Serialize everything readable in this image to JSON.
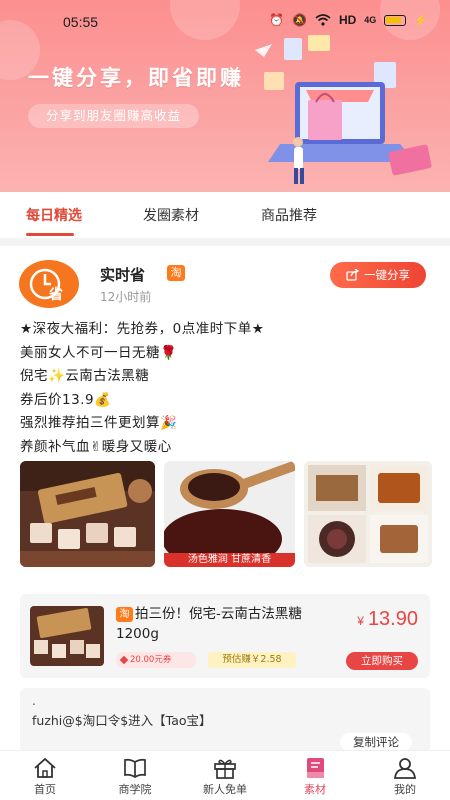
{
  "status_bar": {
    "time": "05:55",
    "network": "HD",
    "signal": "4G"
  },
  "banner": {
    "title": "一键分享，即省即赚",
    "subtitle": "分享到朋友圈赚高收益"
  },
  "tabs": [
    {
      "label": "每日精选",
      "active": true
    },
    {
      "label": "发圈素材",
      "active": false
    },
    {
      "label": "商品推荐",
      "active": false
    }
  ],
  "post": {
    "author": "实时省",
    "avatar_text": "省",
    "platform_badge": "淘",
    "time": "12小时前",
    "share_label": "一键分享",
    "lines": [
      "★深夜大福利：先抢券，0点准时下单★",
      "美丽女人不可一日无糖🌹",
      "倪宅✨云南古法黑糖",
      "券后价13.9💰",
      "强烈推荐拍三件更划算🎉",
      "养颜补气血✌暖身又暖心"
    ],
    "thumb_caption": "汤色雅润 甘蔗清香"
  },
  "product": {
    "badge": "淘",
    "title": "拍三份！倪宅-云南古法黑糖1200g",
    "coupon": "20.00元券",
    "earn": "预估赚￥2.58",
    "price_symbol": "¥",
    "price": "13.90",
    "buy_label": "立即购买"
  },
  "comment": {
    "marker": ".",
    "text": "fuzhi@$淘口令$进入【Tao宝】",
    "copy_label": "复制评论"
  },
  "bottom_nav": [
    {
      "label": "首页",
      "icon": "home-icon",
      "active": false
    },
    {
      "label": "商学院",
      "icon": "book-icon",
      "active": false
    },
    {
      "label": "新人免单",
      "icon": "gift-icon",
      "active": false
    },
    {
      "label": "素材",
      "icon": "material-icon",
      "active": true
    },
    {
      "label": "我的",
      "icon": "person-icon",
      "active": false
    }
  ],
  "colors": {
    "accent": "#e04a38",
    "banner": "#fc9a9a",
    "price": "#e84545"
  }
}
